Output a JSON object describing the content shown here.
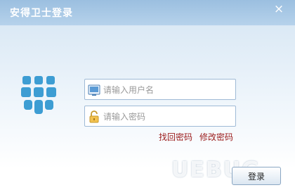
{
  "window": {
    "title": "安得卫士登录",
    "close_glyph": "×"
  },
  "colors": {
    "titlebar": "#9bbfe0",
    "logo_blue": "#3d9dd3",
    "link": "#9b1c1c"
  },
  "form": {
    "username": {
      "value": "",
      "placeholder": "请输入用户名",
      "icon": "user-card-icon"
    },
    "password": {
      "value": "",
      "placeholder": "请输入密码",
      "icon": "lock-icon"
    }
  },
  "links": {
    "recover": "找回密码",
    "change": "修改密码"
  },
  "actions": {
    "login": "登录"
  },
  "watermark": {
    "text": "UEBUG"
  }
}
